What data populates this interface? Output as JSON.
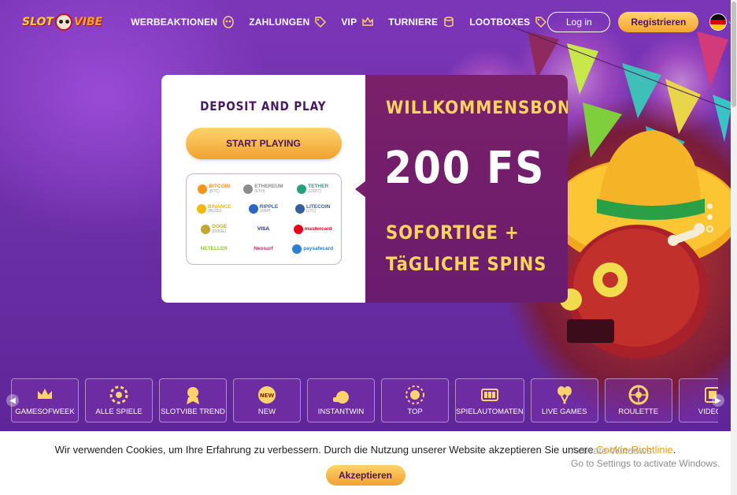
{
  "header": {
    "logo_left": "SLOT",
    "logo_right": "VIBE",
    "nav": [
      {
        "label": "WERBEAKTIONEN",
        "icon": "mask-icon"
      },
      {
        "label": "ZAHLUNGEN",
        "icon": "tag-icon"
      },
      {
        "label": "VIP",
        "icon": "crown-icon"
      },
      {
        "label": "TURNIERE",
        "icon": "coins-icon"
      },
      {
        "label": "LOOTBOXES",
        "icon": "tag-icon"
      }
    ],
    "login_label": "Log in",
    "register_label": "Registrieren",
    "language": "de"
  },
  "hero": {
    "deposit_title": "DEPOSIT AND PLAY",
    "start_button": "START PLAYING",
    "payments": [
      {
        "name": "BITCOIN",
        "sub": "(BTC)",
        "color": "#f7931a"
      },
      {
        "name": "ETHEREUM",
        "sub": "(ETH)",
        "color": "#8c8c8c"
      },
      {
        "name": "TETHER",
        "sub": "(USDT)",
        "color": "#26a17b"
      },
      {
        "name": "BINANCE",
        "sub": "(BUSD)",
        "color": "#f0b90b"
      },
      {
        "name": "RIPPLE",
        "sub": "(XRP)",
        "color": "#2a66c4"
      },
      {
        "name": "LITECOIN",
        "sub": "(LTC)",
        "color": "#345d9d"
      },
      {
        "name": "DOGE",
        "sub": "(DOGE)",
        "color": "#c2a633"
      },
      {
        "name": "VISA",
        "sub": "",
        "color": "#1a1f71"
      },
      {
        "name": "mastercard",
        "sub": "",
        "color": "#eb001b"
      },
      {
        "name": "NETELLER",
        "sub": "",
        "color": "#8dc63f"
      },
      {
        "name": "Neosurf",
        "sub": "",
        "color": "#e6176c"
      },
      {
        "name": "paysafecard",
        "sub": "",
        "color": "#2a7fd4"
      }
    ],
    "bonus_title": "WILLKOMMENSBONUS",
    "bonus_amount": "200 FS",
    "bonus_line1": "SOFORTIGE +",
    "bonus_line2": "TäGLICHE SPINS"
  },
  "categories": [
    {
      "label": "GAMESOFWEEK",
      "icon": "crown-badge-icon"
    },
    {
      "label": "ALLE SPIELE",
      "icon": "chip-icon"
    },
    {
      "label": "SLOTVIBE TREND",
      "icon": "trend-badge-icon"
    },
    {
      "label": "NEW",
      "icon": "new-badge-icon"
    },
    {
      "label": "INSTANTWIN",
      "icon": "money-bag-icon"
    },
    {
      "label": "TOP",
      "icon": "sun-star-icon"
    },
    {
      "label": "SPIELAUTOMATEN",
      "icon": "slot-machine-icon"
    },
    {
      "label": "LIVE GAMES",
      "icon": "maracas-icon"
    },
    {
      "label": "ROULETTE",
      "icon": "roulette-wheel-icon"
    },
    {
      "label": "VIDEOP",
      "icon": "video-poker-icon"
    }
  ],
  "cookie": {
    "text": "Wir verwenden Cookies, um Ihre Erfahrung zu verbessern. Durch die Nutzung unserer Website akzeptieren Sie unsere ",
    "link": "Cookie-Richtlinie",
    "suffix": ".",
    "accept": "Akzeptieren"
  },
  "watermark": {
    "line1": "Activate Windows",
    "line2": "Go to Settings to activate Windows."
  },
  "colors": {
    "brand_purple": "#6b2fa6",
    "card_purple": "#781f6a",
    "accent_gold": "#ffd45e",
    "button_gold": "#f0a130",
    "dark_text": "#4b1862"
  }
}
